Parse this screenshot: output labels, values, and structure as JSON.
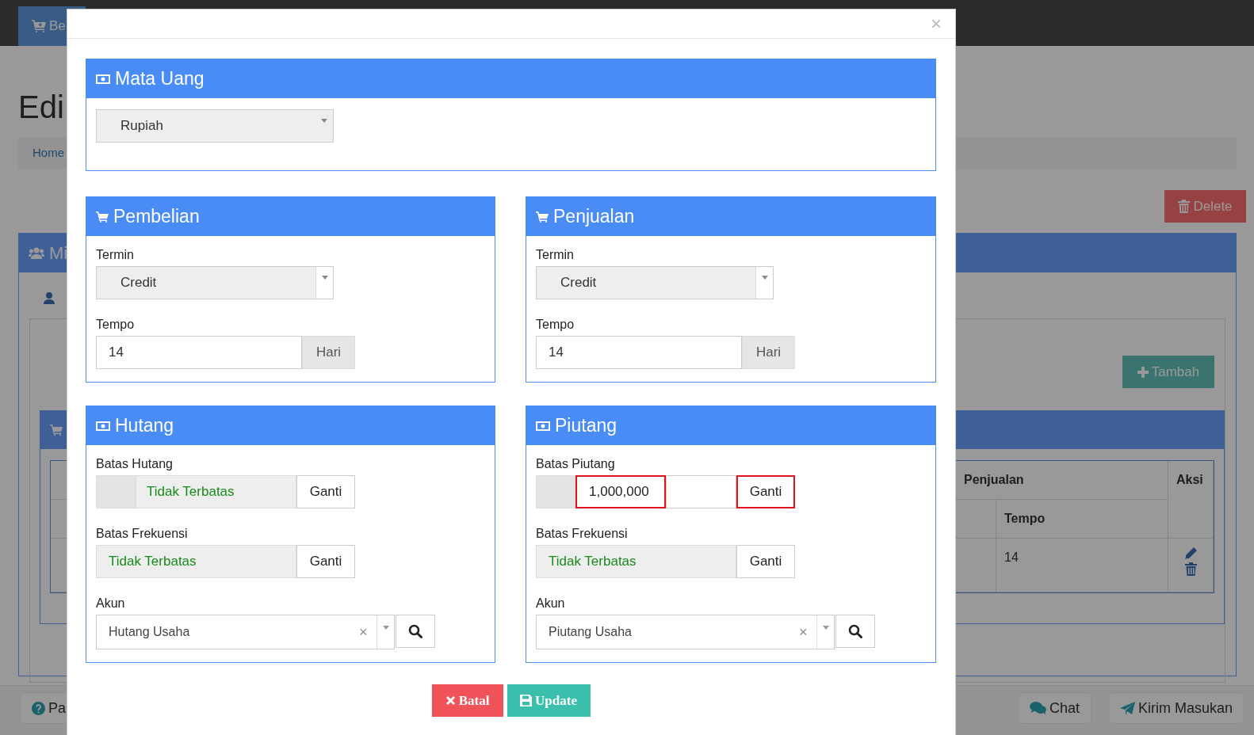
{
  "background": {
    "nav_button": "Be",
    "heading": "Edi",
    "breadcrumb": "Home",
    "delete_button": "Delete",
    "panel_title": "Mi",
    "add_button": "Tambah",
    "table": {
      "group_header": "Penjualan",
      "action_header": "Aksi",
      "sub_header": "Tempo",
      "rows": [
        {
          "tempo": "14"
        }
      ]
    },
    "help_button": "Pa",
    "chat_button": "Chat",
    "feedback_button": "Kirim Masukan"
  },
  "modal": {
    "close": "×",
    "currency": {
      "title": "Mata Uang",
      "value": "Rupiah"
    },
    "terms": [
      {
        "title": "Pembelian",
        "termin_label": "Termin",
        "termin": "Credit",
        "tempo_label": "Tempo",
        "tempo": "14",
        "unit": "Hari"
      },
      {
        "title": "Penjualan",
        "termin_label": "Termin",
        "termin": "Credit",
        "tempo_label": "Tempo",
        "tempo": "14",
        "unit": "Hari"
      }
    ],
    "limits": [
      {
        "title": "Hutang",
        "fields": [
          {
            "kind": "limit",
            "label": "Batas Hutang",
            "value": "Tidak Terbatas",
            "unlimited": true,
            "addon": true,
            "highlighted": false,
            "button": "Ganti",
            "button_highlighted": false
          },
          {
            "kind": "limit",
            "label": "Batas Frekuensi",
            "value": "Tidak Terbatas",
            "unlimited": true,
            "addon": false,
            "highlighted": false,
            "button": "Ganti",
            "button_highlighted": false
          },
          {
            "kind": "account",
            "label": "Akun",
            "value": "Hutang Usaha",
            "clear": "×"
          }
        ]
      },
      {
        "title": "Piutang",
        "fields": [
          {
            "kind": "limit",
            "label": "Batas Piutang",
            "value": "1,000,000",
            "unlimited": false,
            "addon": true,
            "highlighted": true,
            "button": "Ganti",
            "button_highlighted": true
          },
          {
            "kind": "limit",
            "label": "Batas Frekuensi",
            "value": "Tidak Terbatas",
            "unlimited": true,
            "addon": false,
            "highlighted": false,
            "button": "Ganti",
            "button_highlighted": false
          },
          {
            "kind": "account",
            "label": "Akun",
            "value": "Piutang Usaha",
            "clear": "×"
          }
        ]
      }
    ],
    "buttons": [
      {
        "kind": "cancel",
        "label": "Batal"
      },
      {
        "kind": "save",
        "label": "Update"
      }
    ]
  }
}
